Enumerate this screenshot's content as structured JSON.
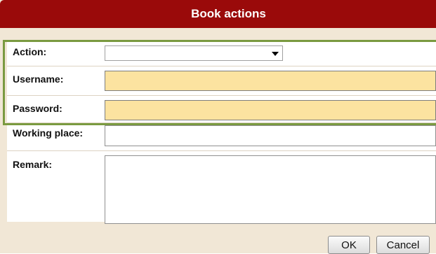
{
  "dialog": {
    "title": "Book actions"
  },
  "form": {
    "action": {
      "label": "Action:",
      "value": ""
    },
    "username": {
      "label": "Username:",
      "value": ""
    },
    "password": {
      "label": "Password:",
      "value": ""
    },
    "working_place": {
      "label": "Working place:",
      "value": ""
    },
    "remark": {
      "label": "Remark:",
      "value": ""
    }
  },
  "buttons": {
    "ok": "OK",
    "cancel": "Cancel"
  },
  "colors": {
    "titlebar": "#9a0a0a",
    "required_field": "#fce3a0",
    "highlight_frame": "#7a9a40",
    "dialog_background": "#f1e7d6"
  }
}
